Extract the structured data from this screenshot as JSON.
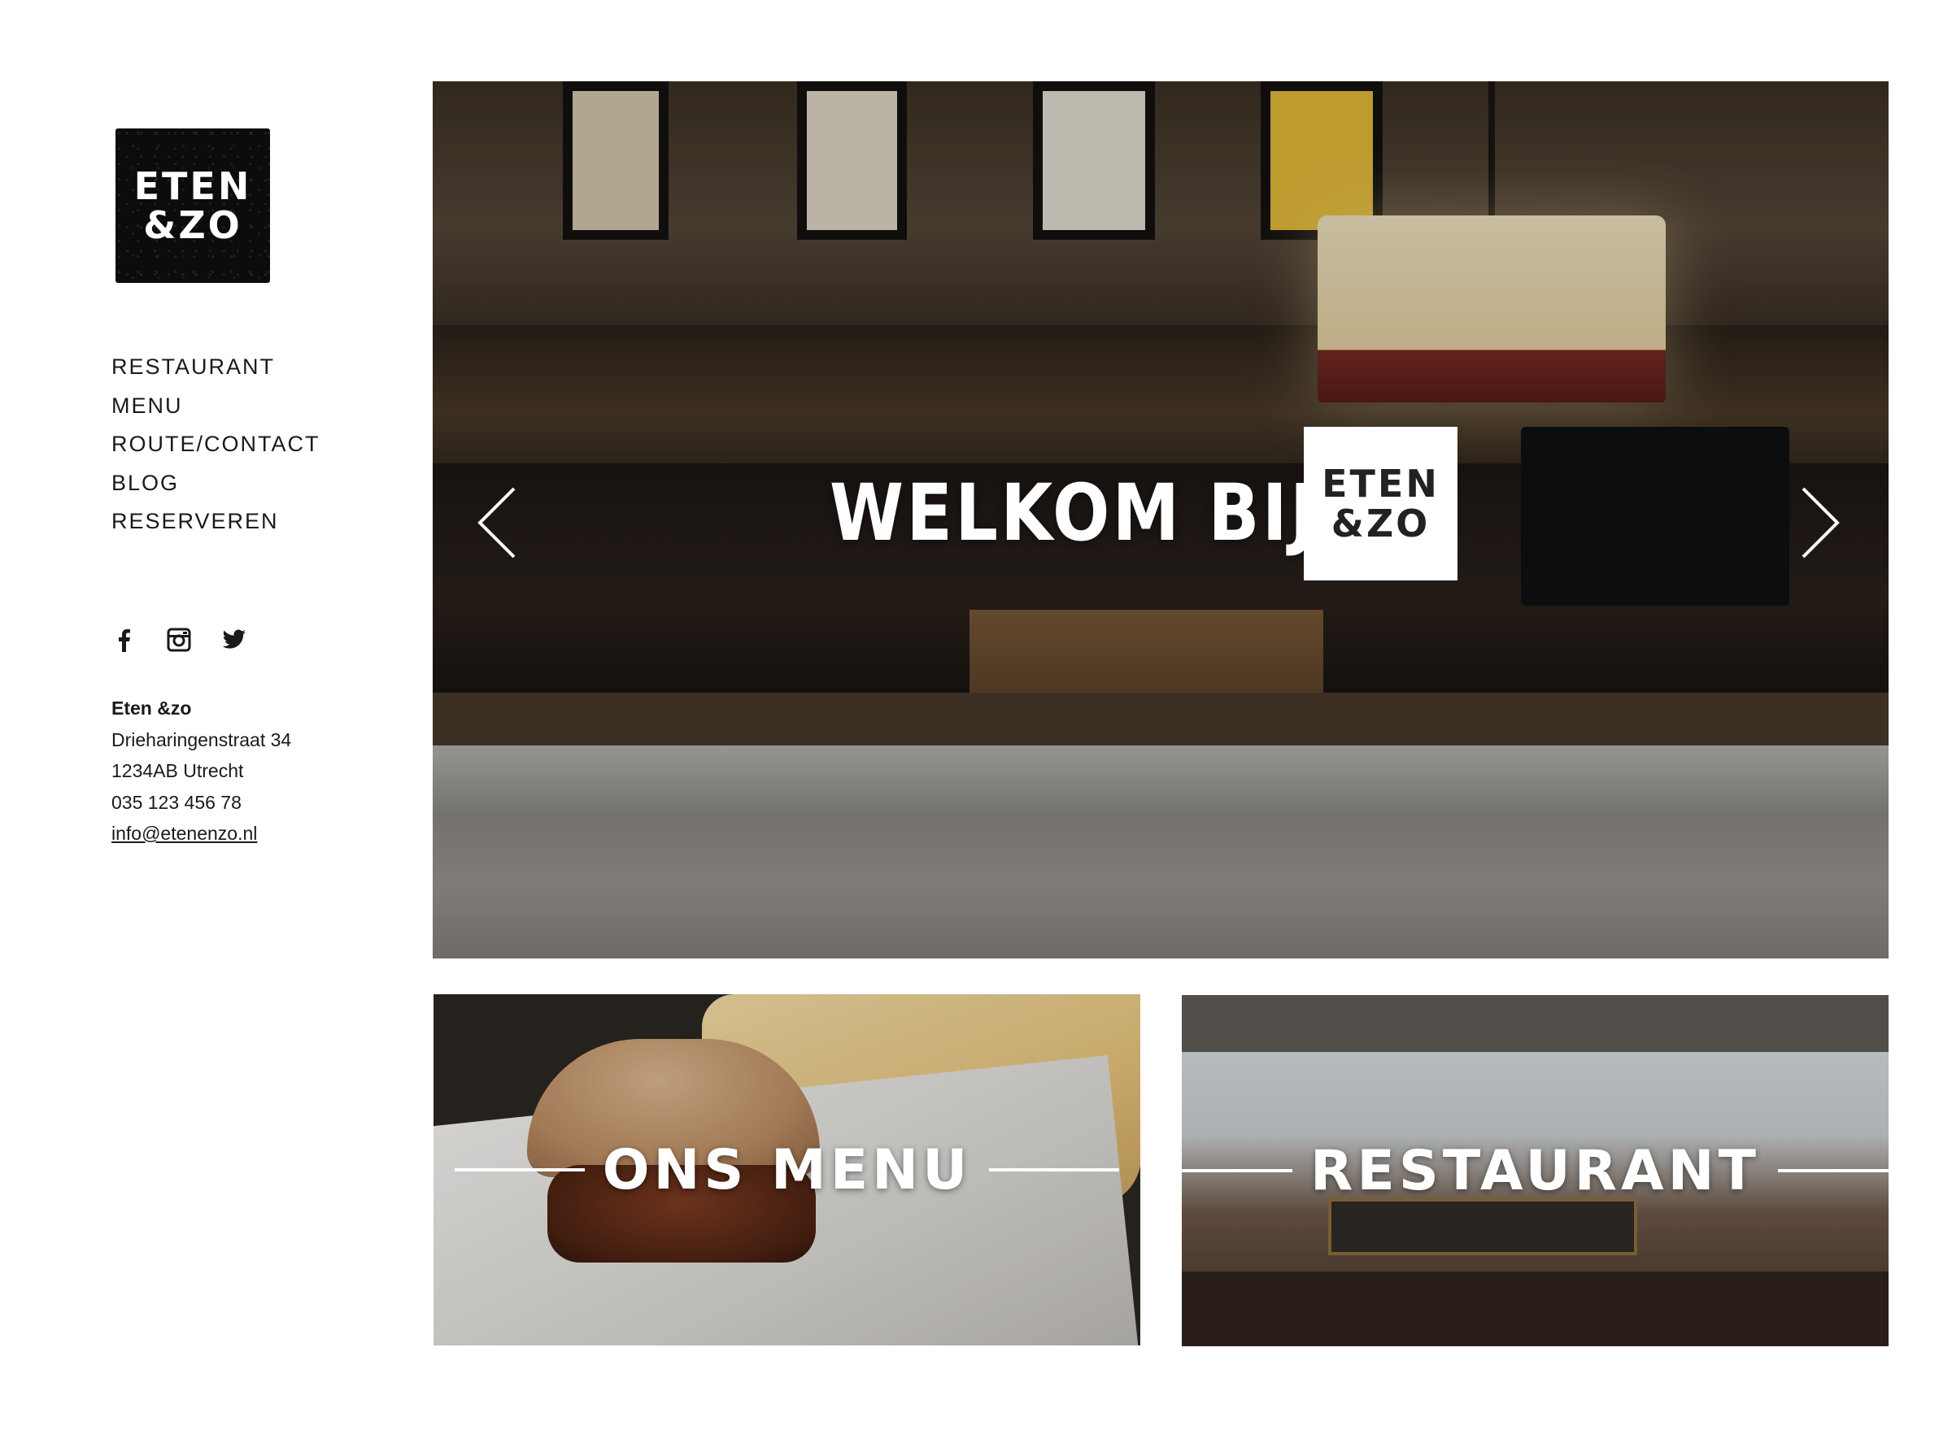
{
  "brand": {
    "logo_line1": "ETEN",
    "logo_line2": "&ZO"
  },
  "nav": {
    "items": [
      {
        "label": "RESTAURANT"
      },
      {
        "label": "MENU"
      },
      {
        "label": "ROUTE/CONTACT"
      },
      {
        "label": "BLOG"
      },
      {
        "label": "RESERVEREN"
      }
    ]
  },
  "social": {
    "icons": [
      "facebook-icon",
      "instagram-icon",
      "twitter-icon"
    ]
  },
  "address": {
    "name": "Eten &zo",
    "street": "Drieharingenstraat 34",
    "city": "1234AB Utrecht",
    "phone": "035 123 456 78",
    "email": "info@etenenzo.nl"
  },
  "hero": {
    "title": "WELKOM BIJ",
    "badge_line1": "ETEN",
    "badge_line2": "&ZO",
    "prev_icon": "chevron-left-icon",
    "next_icon": "chevron-right-icon"
  },
  "tiles": {
    "menu": {
      "label": "ONS MENU"
    },
    "restaurant": {
      "label": "RESTAURANT"
    }
  },
  "colors": {
    "text": "#1a1a1a",
    "logo_bg": "#0c0c0c",
    "overlay_text": "#ffffff"
  }
}
